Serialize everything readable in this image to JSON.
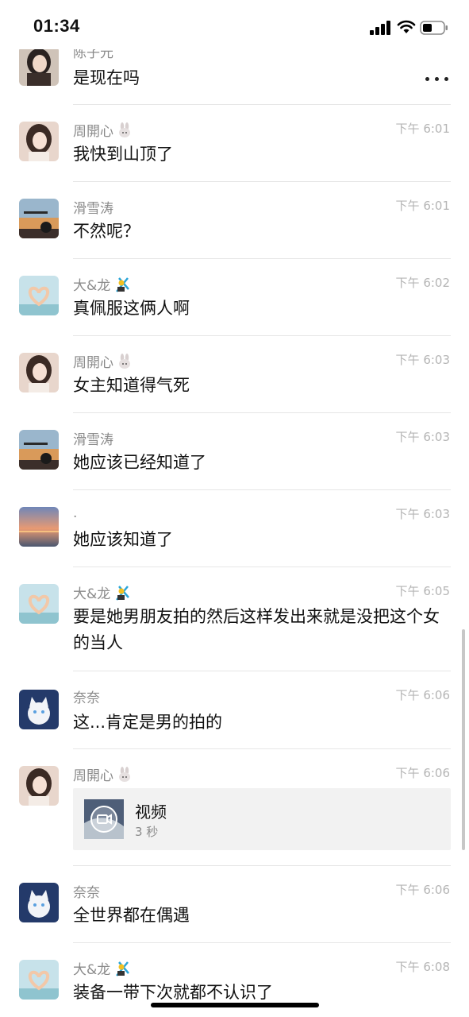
{
  "status_bar": {
    "time": "01:34"
  },
  "top_partial": {
    "sender": "陈子元",
    "message": "是现在吗"
  },
  "messages": [
    {
      "sender": "周開心",
      "emoji": "rabbit",
      "time": "下午 6:01",
      "text": "我快到山顶了",
      "avatar": "girl"
    },
    {
      "sender": "滑雪涛",
      "emoji": "",
      "time": "下午 6:01",
      "text": "不然呢？",
      "avatar": "sunset-silhouette"
    },
    {
      "sender": "大&龙",
      "emoji": "ski",
      "time": "下午 6:02",
      "text": "真佩服这俩人啊",
      "avatar": "heart-hands"
    },
    {
      "sender": "周開心",
      "emoji": "rabbit",
      "time": "下午 6:03",
      "text": "女主知道得气死",
      "avatar": "girl"
    },
    {
      "sender": "滑雪涛",
      "emoji": "",
      "time": "下午 6:03",
      "text": "她应该已经知道了",
      "avatar": "sunset-silhouette"
    },
    {
      "sender": ".",
      "emoji": "",
      "time": "下午 6:03",
      "text": "她应该知道了",
      "avatar": "sea-sunset"
    },
    {
      "sender": "大&龙",
      "emoji": "ski",
      "time": "下午 6:05",
      "text": "要是她男朋友拍的然后这样发出来就是没把这个女的当人",
      "avatar": "heart-hands"
    },
    {
      "sender": "奈奈",
      "emoji": "",
      "time": "下午 6:06",
      "text": "这...肯定是男的拍的",
      "avatar": "white-cat"
    },
    {
      "sender": "周開心",
      "emoji": "rabbit",
      "time": "下午 6:06",
      "text": "",
      "avatar": "girl",
      "video": {
        "title": "视频",
        "duration": "3 秒"
      }
    },
    {
      "sender": "奈奈",
      "emoji": "",
      "time": "下午 6:06",
      "text": "全世界都在偶遇",
      "avatar": "white-cat"
    },
    {
      "sender": "大&龙",
      "emoji": "ski",
      "time": "下午 6:08",
      "text": "装备一带下次就都不认识了",
      "avatar": "heart-hands"
    }
  ],
  "icons": {
    "more": "more-dots-icon",
    "video": "video-camera-icon",
    "signal": "signal-icon",
    "wifi": "wifi-icon",
    "battery": "battery-icon"
  }
}
